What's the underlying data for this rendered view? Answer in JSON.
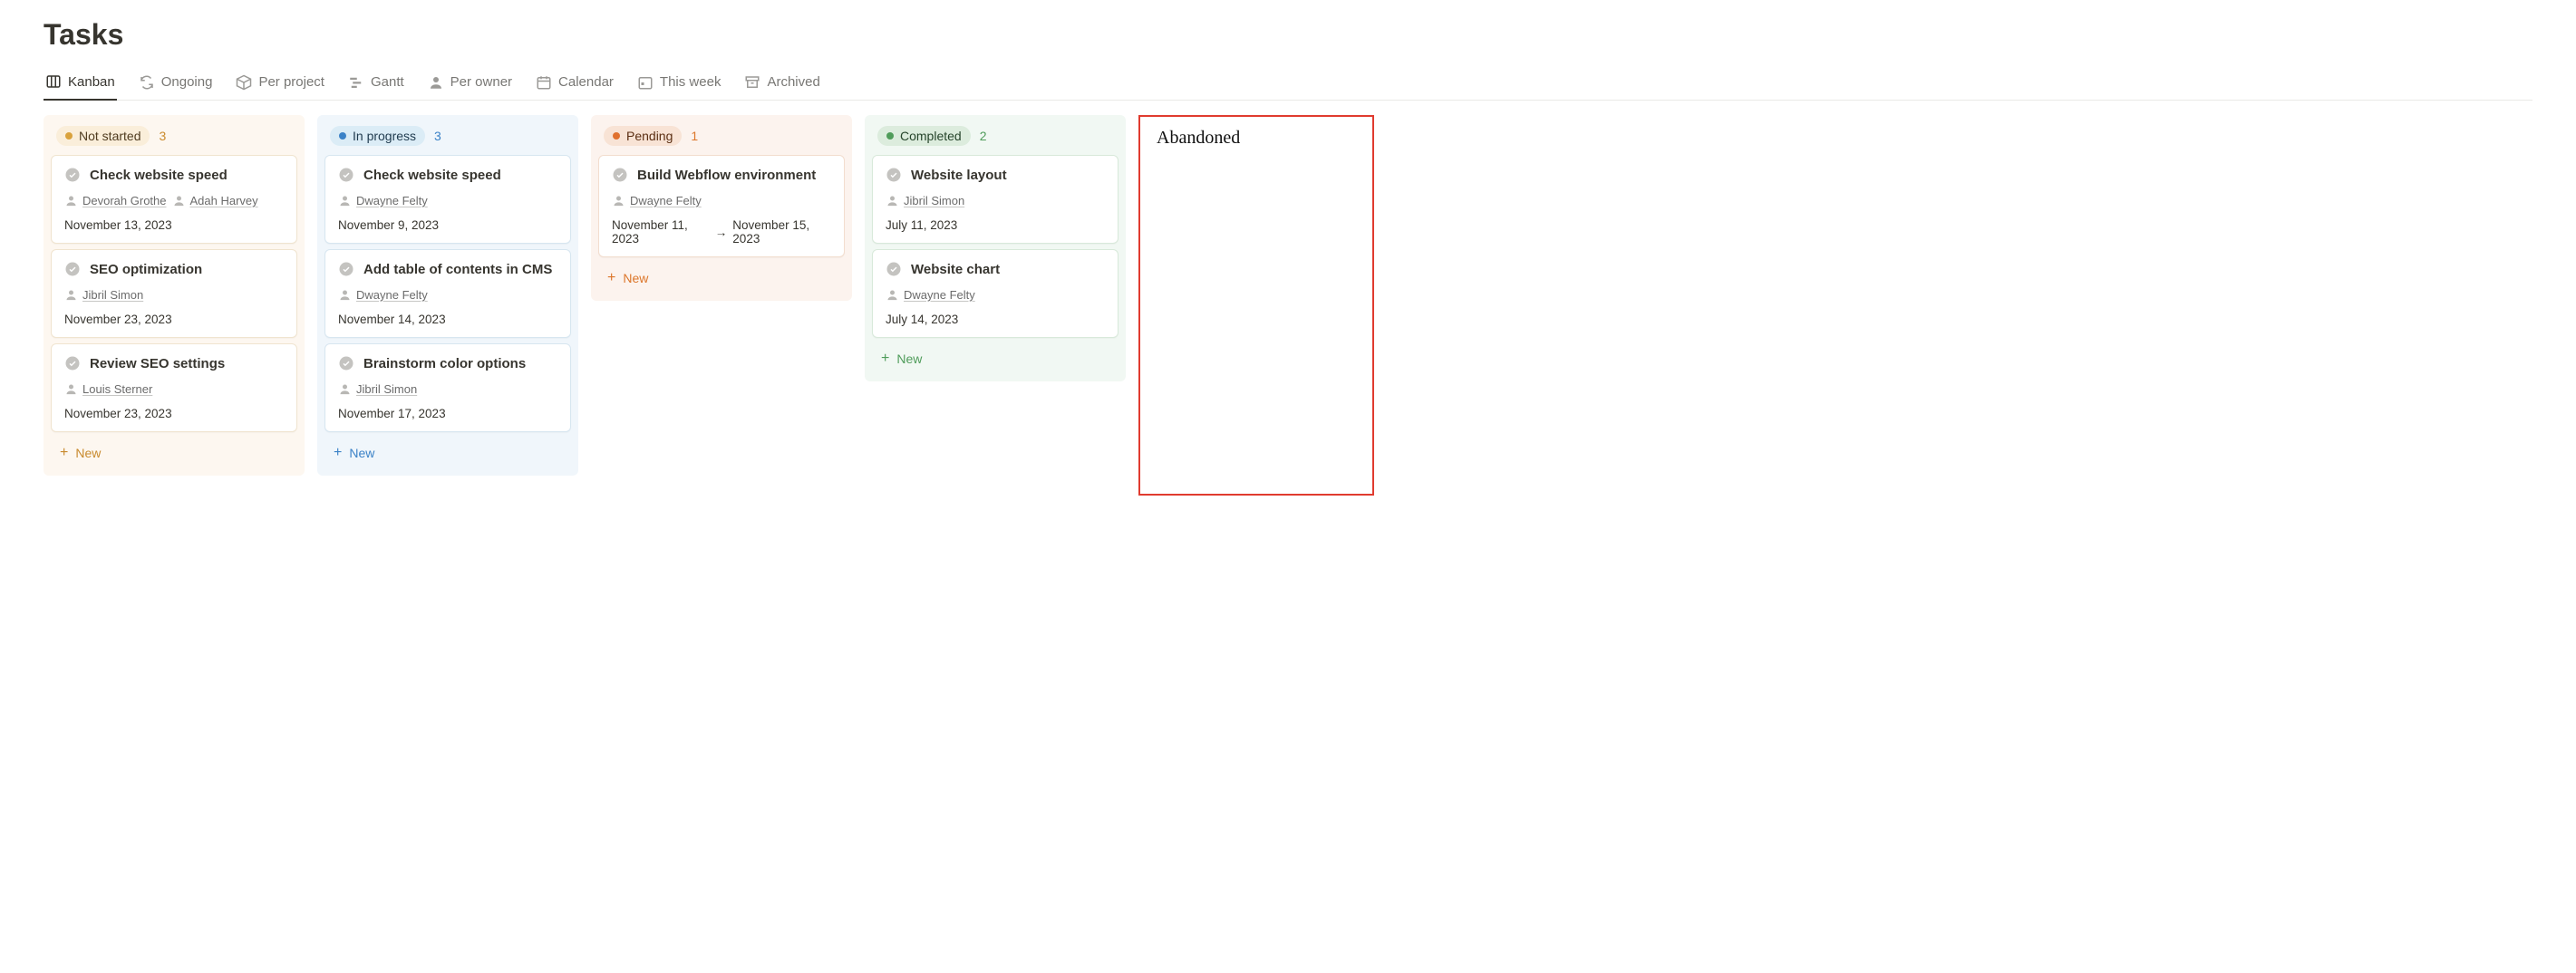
{
  "page_title": "Tasks",
  "tabs": [
    {
      "label": "Kanban",
      "active": true
    },
    {
      "label": "Ongoing"
    },
    {
      "label": "Per project"
    },
    {
      "label": "Gantt"
    },
    {
      "label": "Per owner"
    },
    {
      "label": "Calendar"
    },
    {
      "label": "This week"
    },
    {
      "label": "Archived"
    }
  ],
  "new_label": "New",
  "columns": {
    "not_started": {
      "name": "Not started",
      "count": "3",
      "cards": [
        {
          "title": "Check website speed",
          "owners": [
            "Devorah Grothe",
            "Adah Harvey"
          ],
          "date": "November 13, 2023"
        },
        {
          "title": "SEO optimization",
          "owners": [
            "Jibril Simon"
          ],
          "date": "November 23, 2023"
        },
        {
          "title": "Review SEO settings",
          "owners": [
            "Louis Sterner"
          ],
          "date": "November 23, 2023"
        }
      ]
    },
    "in_progress": {
      "name": "In progress",
      "count": "3",
      "cards": [
        {
          "title": "Check website speed",
          "owners": [
            "Dwayne Felty"
          ],
          "date": "November 9, 2023"
        },
        {
          "title": "Add table of contents in CMS",
          "owners": [
            "Dwayne Felty"
          ],
          "date": "November 14, 2023"
        },
        {
          "title": "Brainstorm color options",
          "owners": [
            "Jibril Simon"
          ],
          "date": "November 17, 2023"
        }
      ]
    },
    "pending": {
      "name": "Pending",
      "count": "1",
      "cards": [
        {
          "title": "Build Webflow environment",
          "owners": [
            "Dwayne Felty"
          ],
          "date_start": "November 11, 2023",
          "date_end": "November 15, 2023"
        }
      ]
    },
    "completed": {
      "name": "Completed",
      "count": "2",
      "cards": [
        {
          "title": "Website layout",
          "owners": [
            "Jibril Simon"
          ],
          "date": "July 11, 2023"
        },
        {
          "title": "Website chart",
          "owners": [
            "Dwayne Felty"
          ],
          "date": "July 14, 2023"
        }
      ]
    }
  },
  "abandoned_label": "Abandoned"
}
